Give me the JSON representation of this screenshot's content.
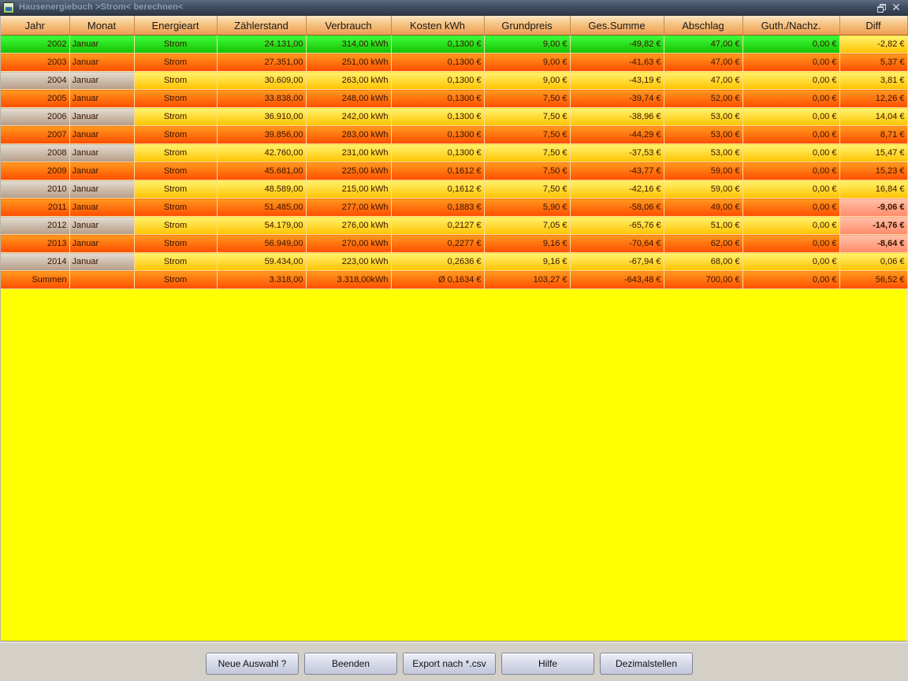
{
  "window": {
    "title": "Hausenergiebuch >Strom< berechnen<",
    "restore_icon": "restore-icon",
    "close_icon": "close-icon",
    "close_glyph": "✕"
  },
  "colors": {
    "header_gradient": [
      "#fbe6c8",
      "#ef9d52"
    ],
    "row_orange": [
      "#ff9a1e",
      "#ff4d00"
    ],
    "row_yellow": [
      "#fff36e",
      "#ffc200"
    ],
    "row_green": [
      "#3cff3c",
      "#16c000"
    ],
    "diff_negative": [
      "#ffc2a8",
      "#ff8a6a"
    ],
    "background": "#ffff00"
  },
  "table": {
    "columns": [
      "Jahr",
      "Monat",
      "Energieart",
      "Zählerstand",
      "Verbrauch",
      "Kosten kWh",
      "Grundpreis",
      "Ges.Summe",
      "Abschlag",
      "Guth./Nachz.",
      "Diff"
    ],
    "rows": [
      {
        "style": "green",
        "diff_style": "yellow",
        "cells": [
          "2002",
          "Januar",
          "Strom",
          "24.131,00",
          "314,00 kWh",
          "0,1300 €",
          "9,00 €",
          "-49,82 €",
          "47,00 €",
          "0,00 €",
          "-2,82 €"
        ]
      },
      {
        "style": "odd",
        "diff_style": "",
        "cells": [
          "2003",
          "Januar",
          "Strom",
          "27.351,00",
          "251,00 kWh",
          "0,1300 €",
          "9,00 €",
          "-41,63 €",
          "47,00 €",
          "0,00 €",
          "5,37 €"
        ]
      },
      {
        "style": "even",
        "diff_style": "",
        "cells": [
          "2004",
          "Januar",
          "Strom",
          "30.609,00",
          "263,00 kWh",
          "0,1300 €",
          "9,00 €",
          "-43,19 €",
          "47,00 €",
          "0,00 €",
          "3,81 €"
        ]
      },
      {
        "style": "odd",
        "diff_style": "",
        "cells": [
          "2005",
          "Januar",
          "Strom",
          "33.838,00",
          "248,00 kWh",
          "0,1300 €",
          "7,50 €",
          "-39,74 €",
          "52,00 €",
          "0,00 €",
          "12,26 €"
        ]
      },
      {
        "style": "even",
        "diff_style": "",
        "cells": [
          "2006",
          "Januar",
          "Strom",
          "36.910,00",
          "242,00 kWh",
          "0,1300 €",
          "7,50 €",
          "-38,96 €",
          "53,00 €",
          "0,00 €",
          "14,04 €"
        ]
      },
      {
        "style": "odd",
        "diff_style": "",
        "cells": [
          "2007",
          "Januar",
          "Strom",
          "39.856,00",
          "283,00 kWh",
          "0,1300 €",
          "7,50 €",
          "-44,29 €",
          "53,00 €",
          "0,00 €",
          "8,71 €"
        ]
      },
      {
        "style": "even",
        "diff_style": "",
        "cells": [
          "2008",
          "Januar",
          "Strom",
          "42.760,00",
          "231,00 kWh",
          "0,1300 €",
          "7,50 €",
          "-37,53 €",
          "53,00 €",
          "0,00 €",
          "15,47 €"
        ]
      },
      {
        "style": "odd",
        "diff_style": "",
        "cells": [
          "2009",
          "Januar",
          "Strom",
          "45.681,00",
          "225,00 kWh",
          "0,1612 €",
          "7,50 €",
          "-43,77 €",
          "59,00 €",
          "0,00 €",
          "15,23 €"
        ]
      },
      {
        "style": "even",
        "diff_style": "",
        "cells": [
          "2010",
          "Januar",
          "Strom",
          "48.589,00",
          "215,00 kWh",
          "0,1612 €",
          "7,50 €",
          "-42,16 €",
          "59,00 €",
          "0,00 €",
          "16,84 €"
        ]
      },
      {
        "style": "odd",
        "diff_style": "negative",
        "cells": [
          "2011",
          "Januar",
          "Strom",
          "51.485,00",
          "277,00 kWh",
          "0,1883 €",
          "5,90 €",
          "-58,06 €",
          "49,00 €",
          "0,00 €",
          "-9,06 €"
        ]
      },
      {
        "style": "even",
        "diff_style": "negative",
        "cells": [
          "2012",
          "Januar",
          "Strom",
          "54.179,00",
          "276,00 kWh",
          "0,2127 €",
          "7,05 €",
          "-65,76 €",
          "51,00 €",
          "0,00 €",
          "-14,76 €"
        ]
      },
      {
        "style": "odd",
        "diff_style": "negative",
        "cells": [
          "2013",
          "Januar",
          "Strom",
          "56.949,00",
          "270,00 kWh",
          "0,2277 €",
          "9,16 €",
          "-70,64 €",
          "62,00 €",
          "0,00 €",
          "-8,64 €"
        ]
      },
      {
        "style": "even",
        "diff_style": "",
        "cells": [
          "2014",
          "Januar",
          "Strom",
          "59.434,00",
          "223,00 kWh",
          "0,2636 €",
          "9,16 €",
          "-67,94 €",
          "68,00 €",
          "0,00 €",
          "0,06 €"
        ]
      },
      {
        "style": "odd",
        "diff_style": "",
        "cells": [
          "Summen",
          "",
          "Strom",
          "3.318,00",
          "3.318,00kWh",
          "Ø 0,1634 €",
          "103,27 €",
          "-643,48 €",
          "700,00 €",
          "0,00 €",
          "56,52 €"
        ]
      }
    ]
  },
  "buttons": [
    {
      "label": "Neue Auswahl ?"
    },
    {
      "label": "Beenden"
    },
    {
      "label": "Export nach *.csv"
    },
    {
      "label": "Hilfe"
    },
    {
      "label": "Dezimalstellen"
    }
  ]
}
